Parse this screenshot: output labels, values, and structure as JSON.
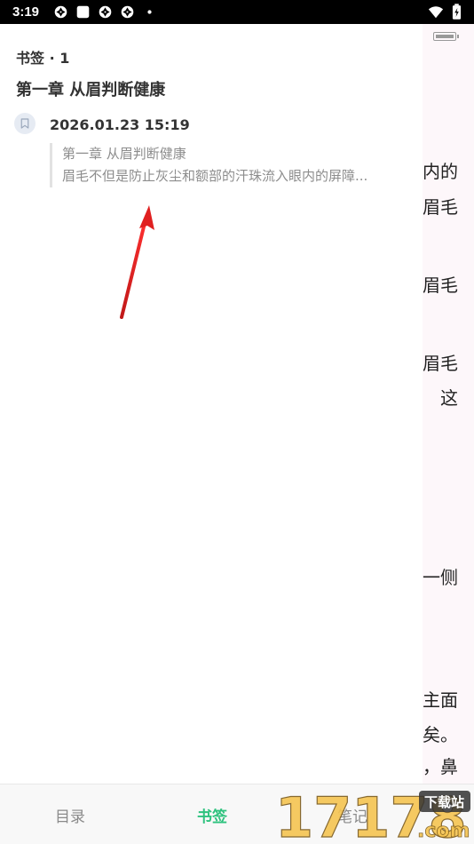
{
  "status_bar": {
    "time": "3:19",
    "left_icons": [
      "aperture-icon",
      "square-icon",
      "aperture-icon",
      "aperture-icon",
      "dot-icon"
    ],
    "right_icons": [
      "wifi-icon",
      "battery-charging-icon"
    ]
  },
  "panel": {
    "header": "书签 · 1",
    "chapter_title": "第一章 从眉判断健康",
    "bookmarks": [
      {
        "date": "2026.01.23 15:19",
        "quote_title": "第一章 从眉判断健康",
        "quote_text": "眉毛不但是防止灰尘和额部的汗珠流入眼内的屏障..."
      }
    ]
  },
  "reader": {
    "lines": [
      "内的",
      "眉毛",
      "眉毛",
      "眉毛",
      "这",
      "一侧",
      "主面",
      "矣。",
      "，鼻"
    ]
  },
  "tab_bar": {
    "tabs": [
      {
        "label": "目录",
        "active": false
      },
      {
        "label": "书签",
        "active": true
      },
      {
        "label": "笔记",
        "active": false
      }
    ]
  },
  "watermark": {
    "number": "17178",
    "top_text": "下载站",
    "bottom_text": ".com"
  },
  "colors": {
    "accent_green": "#2ec27e",
    "annotation_red": "#e02020"
  }
}
